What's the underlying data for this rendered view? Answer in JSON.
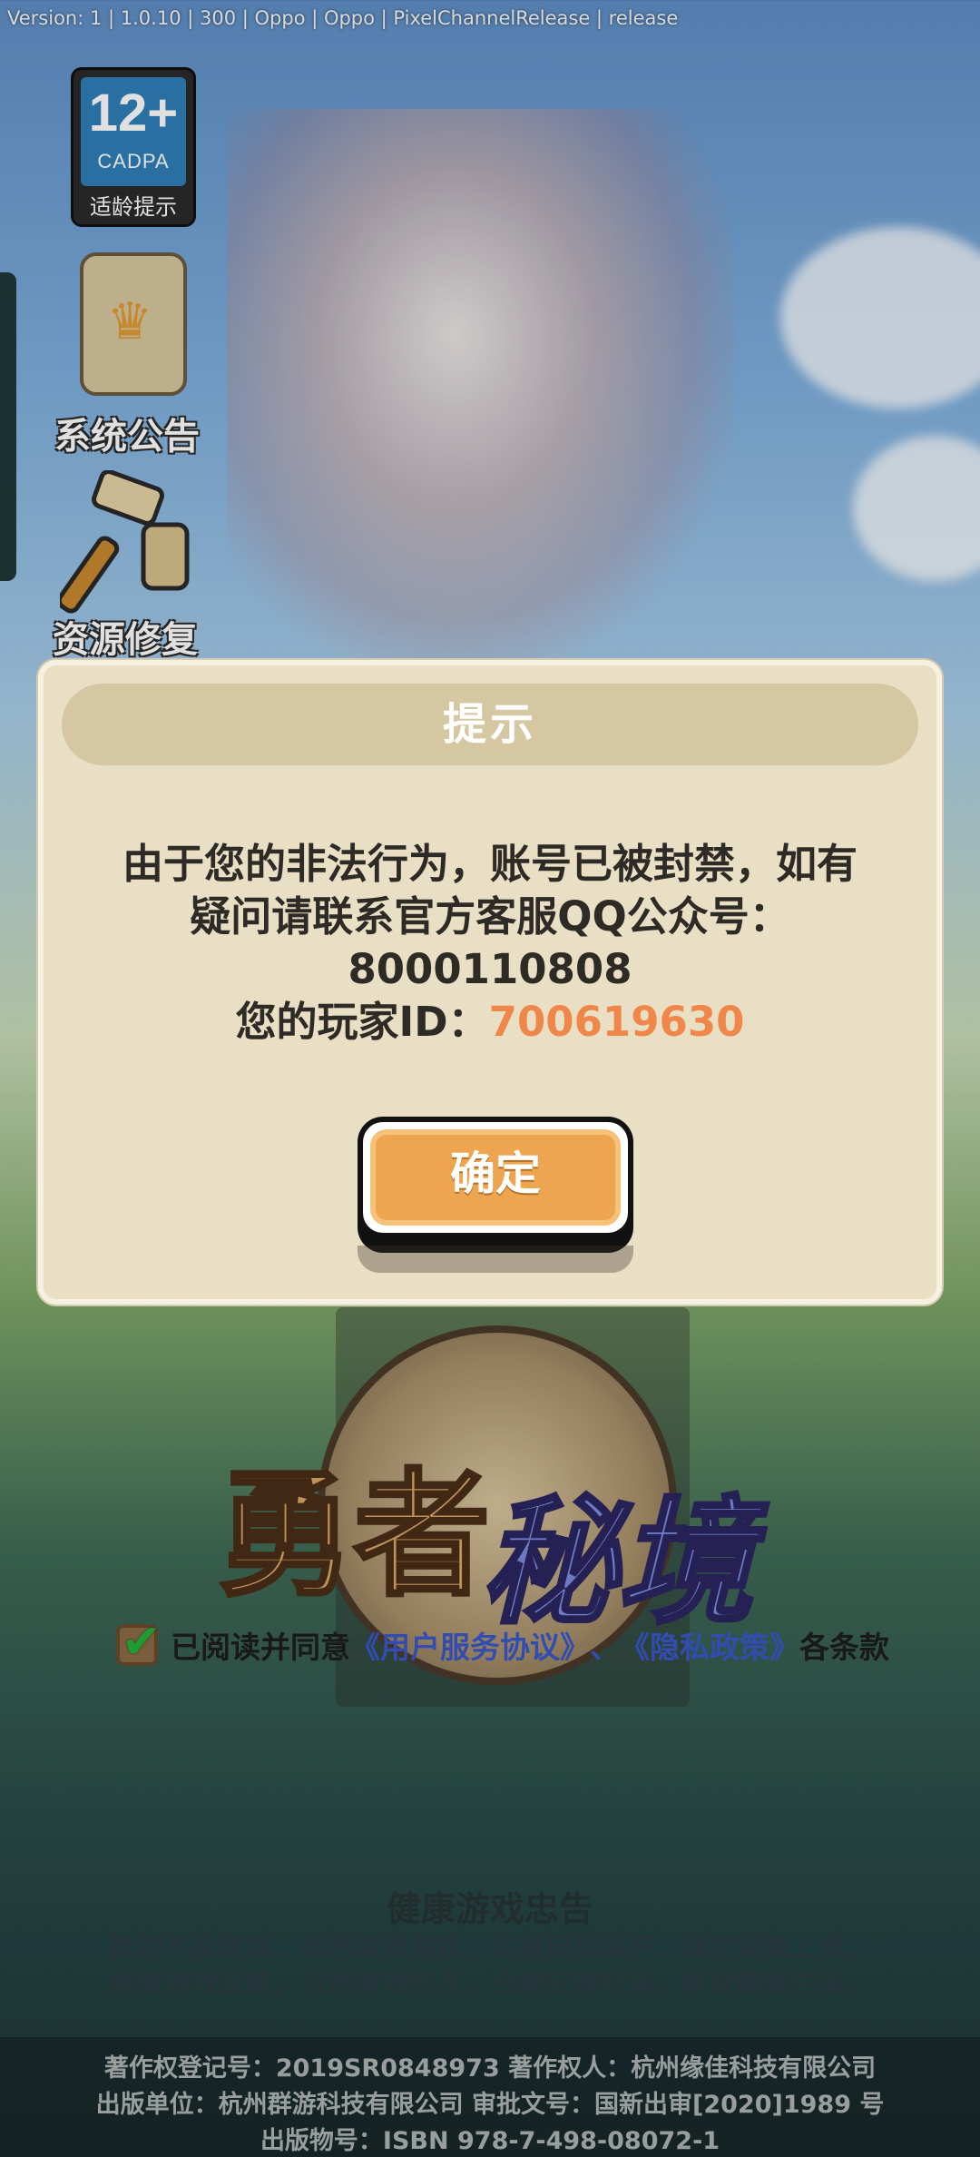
{
  "version_text": "Version: 1 | 1.0.10 | 300 | Oppo | Oppo | PixelChannelRelease | release",
  "side_menu": {
    "age_badge": {
      "number": "12+",
      "org": "CADPA",
      "label": "适龄提示"
    },
    "notice": {
      "label": "系统公告"
    },
    "repair": {
      "label": "资源修复"
    }
  },
  "dialog": {
    "title": "提示",
    "message_line1": "由于您的非法行为，账号已被封禁，如有",
    "message_line2": "疑问请联系官方客服QQ公众号：",
    "message_line3": "8000110808",
    "player_id_label": "您的玩家ID：",
    "player_id_value": "700619630",
    "ok_label": "确定"
  },
  "game_logo": {
    "left_text": "勇者",
    "right_text": "秘境"
  },
  "agreement": {
    "prefix": "已阅读并同意",
    "link1": "《用户服务协议》",
    "sep": "、",
    "link2": "《隐私政策》",
    "suffix": "各条款",
    "checked": true
  },
  "health_notice": {
    "title": "健康游戏忠告",
    "line1": "抵制不良游戏，拒绝盗版游戏。注意自我保护，谨防受骗上当。",
    "line2": "适度游戏益脑，沉迷游戏伤身。合理安排时间，享受健康生活。"
  },
  "footer": {
    "line1": "著作权登记号：2019SR0848973 著作权人：杭州缘佳科技有限公司",
    "line2": "出版单位：杭州群游科技有限公司 审批文号：国新出审[2020]1989 号",
    "line3": "出版物号：ISBN 978-7-498-08072-1"
  },
  "colors": {
    "dialog_bg": "#e9dfc4",
    "title_bar": "#d6c7a3",
    "accent_orange": "#f0874a",
    "button": "#eda64f",
    "link_blue": "#3a57c9"
  }
}
